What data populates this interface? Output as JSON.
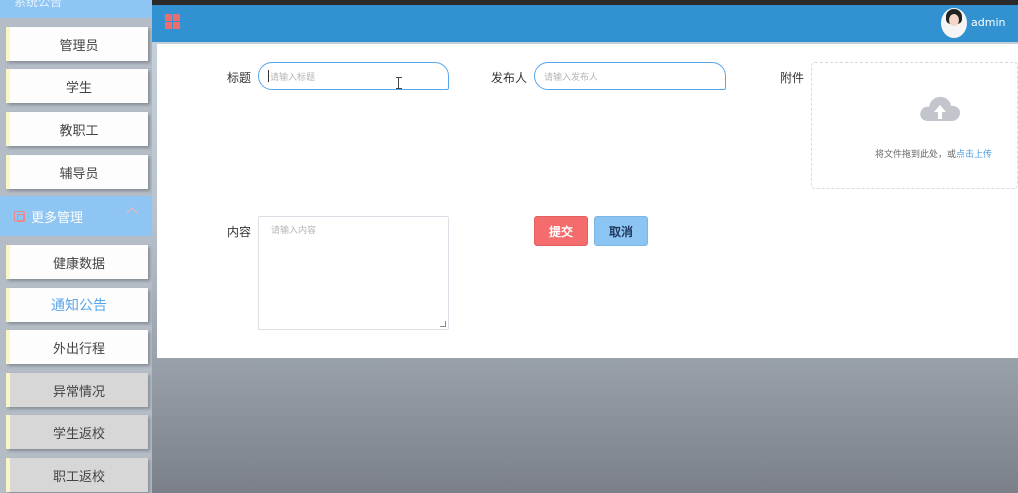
{
  "sidebar": {
    "top_partial_label": "系统公告",
    "items": [
      {
        "label": "管理员"
      },
      {
        "label": "学生"
      },
      {
        "label": "教职工"
      },
      {
        "label": "辅导员"
      }
    ],
    "section": {
      "label": "更多管理"
    },
    "sub_items": [
      {
        "label": "健康数据"
      },
      {
        "label": "通知公告"
      },
      {
        "label": "外出行程"
      },
      {
        "label": "异常情况"
      },
      {
        "label": "学生返校"
      },
      {
        "label": "职工返校"
      }
    ]
  },
  "header": {
    "user": "admin"
  },
  "form": {
    "title_label": "标题",
    "title_placeholder": "请输入标题",
    "publisher_label": "发布人",
    "publisher_placeholder": "请输入发布人",
    "attachment_label": "附件",
    "upload_tip": "将文件拖到此处，或",
    "upload_link": "点击上传",
    "content_label": "内容",
    "content_placeholder": "请输入内容",
    "submit_label": "提交",
    "cancel_label": "取消"
  },
  "colors": {
    "header": "#3191d1",
    "sidebar_accent": "#8ec5f2",
    "submit": "#f56c6c",
    "cancel": "#8cc4f2",
    "active_text": "#5aa6e8"
  }
}
